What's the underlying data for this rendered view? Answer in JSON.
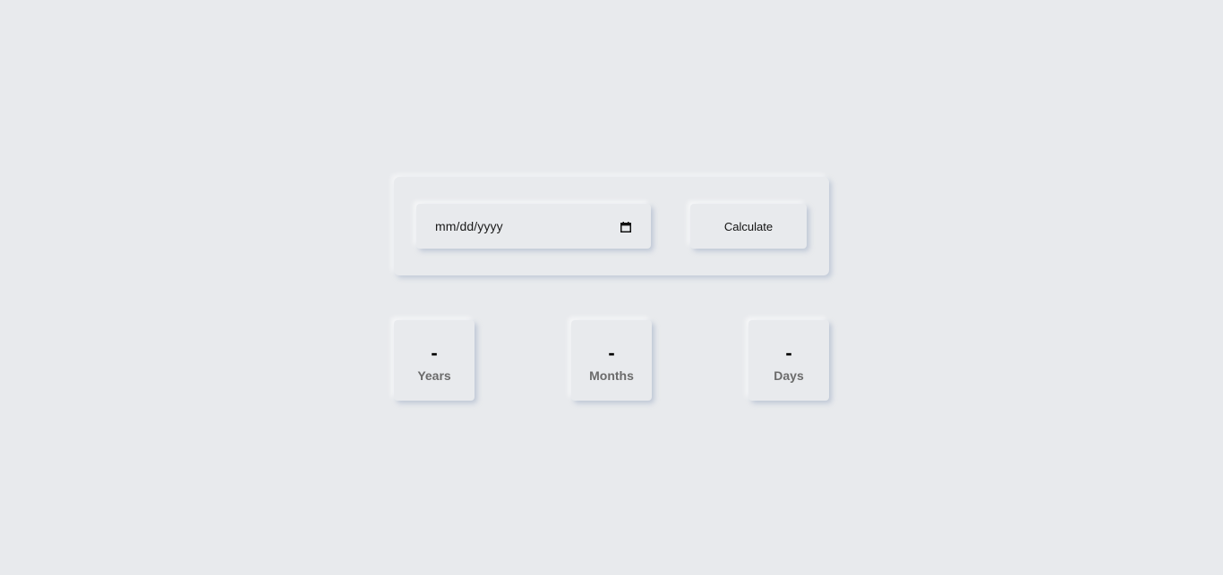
{
  "form": {
    "date_placeholder": "mm/dd/yyyy",
    "calendar_icon": "calendar-icon",
    "calculate_label": "Calculate"
  },
  "results": {
    "years": {
      "value": "-",
      "label": "Years"
    },
    "months": {
      "value": "-",
      "label": "Months"
    },
    "days": {
      "value": "-",
      "label": "Days"
    }
  },
  "colors": {
    "background": "#e8eaed",
    "label_text": "#6b6b6b",
    "value_text": "#000000"
  }
}
